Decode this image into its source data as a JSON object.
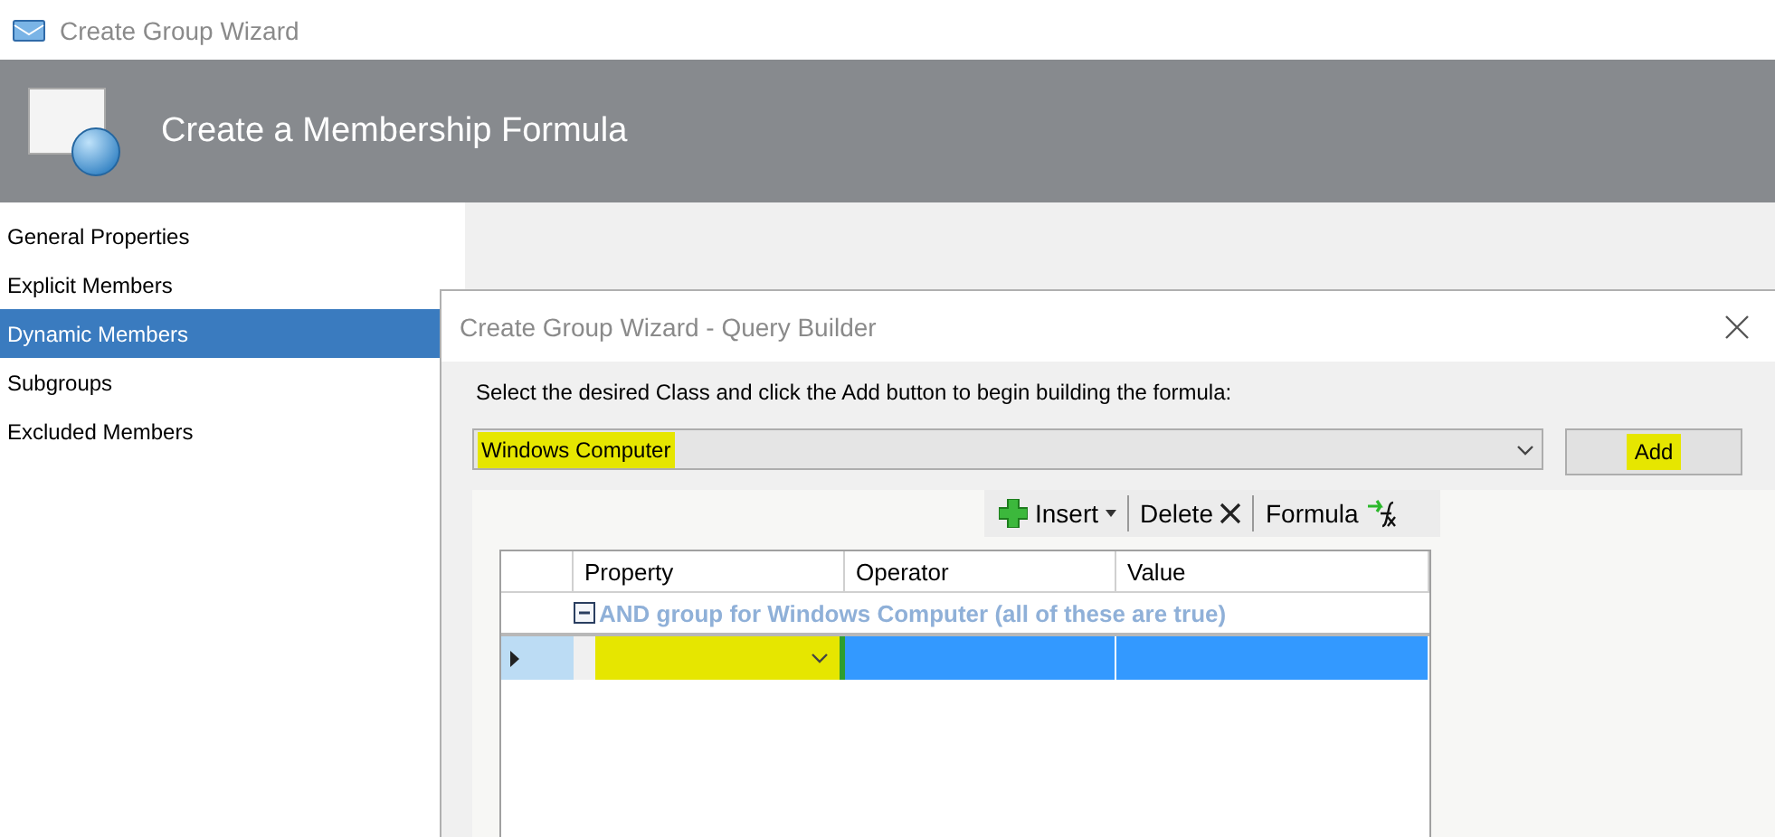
{
  "window": {
    "title": "Create Group Wizard"
  },
  "header": {
    "title": "Create a Membership Formula"
  },
  "sidebar": {
    "items": [
      {
        "label": "General Properties",
        "selected": false
      },
      {
        "label": "Explicit Members",
        "selected": false
      },
      {
        "label": "Dynamic Members",
        "selected": true
      },
      {
        "label": "Subgroups",
        "selected": false
      },
      {
        "label": "Excluded Members",
        "selected": false
      }
    ]
  },
  "dialog": {
    "title": "Create Group Wizard - Query Builder",
    "instruction": "Select the desired Class and click the Add button to begin building the formula:",
    "class_select": {
      "value": "Windows Computer",
      "highlighted": true
    },
    "add_button": {
      "label": "Add",
      "highlighted": true
    },
    "toolbar": [
      {
        "label": "Insert",
        "kind": "insert"
      },
      {
        "label": "Delete",
        "kind": "delete"
      },
      {
        "label": "Formula",
        "kind": "formula"
      }
    ],
    "grid": {
      "columns": [
        "Property",
        "Operator",
        "Value"
      ],
      "group_row": {
        "label": "AND group for Windows Computer (all of these are true)",
        "expanded": true
      },
      "rows": [
        {
          "selected": true,
          "property_highlighted": true
        }
      ]
    }
  }
}
